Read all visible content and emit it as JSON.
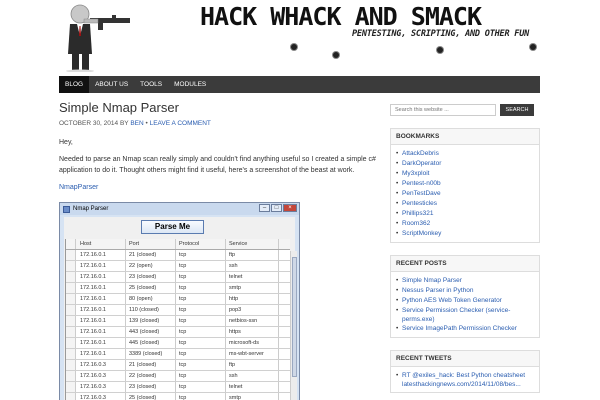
{
  "header": {
    "site_title": "HACK WHACK AND SMACK",
    "tagline": "PENTESTING, SCRIPTING, AND OTHER FUN"
  },
  "nav": {
    "items": [
      {
        "label": "BLOG",
        "active": true
      },
      {
        "label": "ABOUT US",
        "active": false
      },
      {
        "label": "TOOLS",
        "active": false
      },
      {
        "label": "MODULES",
        "active": false
      }
    ]
  },
  "post": {
    "title": "Simple Nmap Parser",
    "date": "OCTOBER 30, 2014",
    "by": "BY",
    "author": "BEN",
    "separator": "•",
    "comment_link": "LEAVE A COMMENT",
    "greeting": "Hey,",
    "paragraph": "Needed to parse an Nmap scan really simply and couldn't find anything useful so I created a simple c# application to do it. Thought others might find it useful, here's a screenshot of the beast at work.",
    "download_link": "NmapParser"
  },
  "app": {
    "window_title": "Nmap Parser",
    "parse_button": "Parse Me",
    "columns": [
      "Host",
      "Port",
      "Protocol",
      "Service"
    ],
    "rows": [
      [
        "172.16.0.1",
        "21 (closed)",
        "tcp",
        "ftp"
      ],
      [
        "172.16.0.1",
        "22 (open)",
        "tcp",
        "ssh"
      ],
      [
        "172.16.0.1",
        "23 (closed)",
        "tcp",
        "telnet"
      ],
      [
        "172.16.0.1",
        "25 (closed)",
        "tcp",
        "smtp"
      ],
      [
        "172.16.0.1",
        "80 (open)",
        "tcp",
        "http"
      ],
      [
        "172.16.0.1",
        "110 (closed)",
        "tcp",
        "pop3"
      ],
      [
        "172.16.0.1",
        "139 (closed)",
        "tcp",
        "netbios-ssn"
      ],
      [
        "172.16.0.1",
        "443 (closed)",
        "tcp",
        "https"
      ],
      [
        "172.16.0.1",
        "445 (closed)",
        "tcp",
        "microsoft-ds"
      ],
      [
        "172.16.0.1",
        "3389 (closed)",
        "tcp",
        "ms-wbt-server"
      ],
      [
        "172.16.0.3",
        "21 (closed)",
        "tcp",
        "ftp"
      ],
      [
        "172.16.0.3",
        "22 (closed)",
        "tcp",
        "ssh"
      ],
      [
        "172.16.0.3",
        "23 (closed)",
        "tcp",
        "telnet"
      ],
      [
        "172.16.0.3",
        "25 (closed)",
        "tcp",
        "smtp"
      ]
    ]
  },
  "sidebar": {
    "search_placeholder": "Search this website ...",
    "search_button": "SEARCH",
    "bookmarks": {
      "title": "BOOKMARKS",
      "items": [
        "AttackDebris",
        "DarkOperator",
        "My3xploit",
        "Pentest-n00b",
        "PenTestDave",
        "Pentesticles",
        "Phillips321",
        "Room362",
        "ScriptMonkey"
      ]
    },
    "recent_posts": {
      "title": "RECENT POSTS",
      "items": [
        "Simple Nmap Parser",
        "Nessus Parser in Python",
        "Python AES Web Token Generator",
        "Service Permission Checker (service-perms.exe)",
        "Service ImagePath Permission Checker"
      ]
    },
    "recent_tweets": {
      "title": "RECENT TWEETS",
      "items": [
        "RT @exiles_hack: Best Python cheatsheet latesthackingnews.com/2014/11/08/bes..."
      ]
    }
  },
  "colors": {
    "nav_bg": "#3b3b3b",
    "link": "#2a5db0",
    "window_close": "#c4473a"
  }
}
